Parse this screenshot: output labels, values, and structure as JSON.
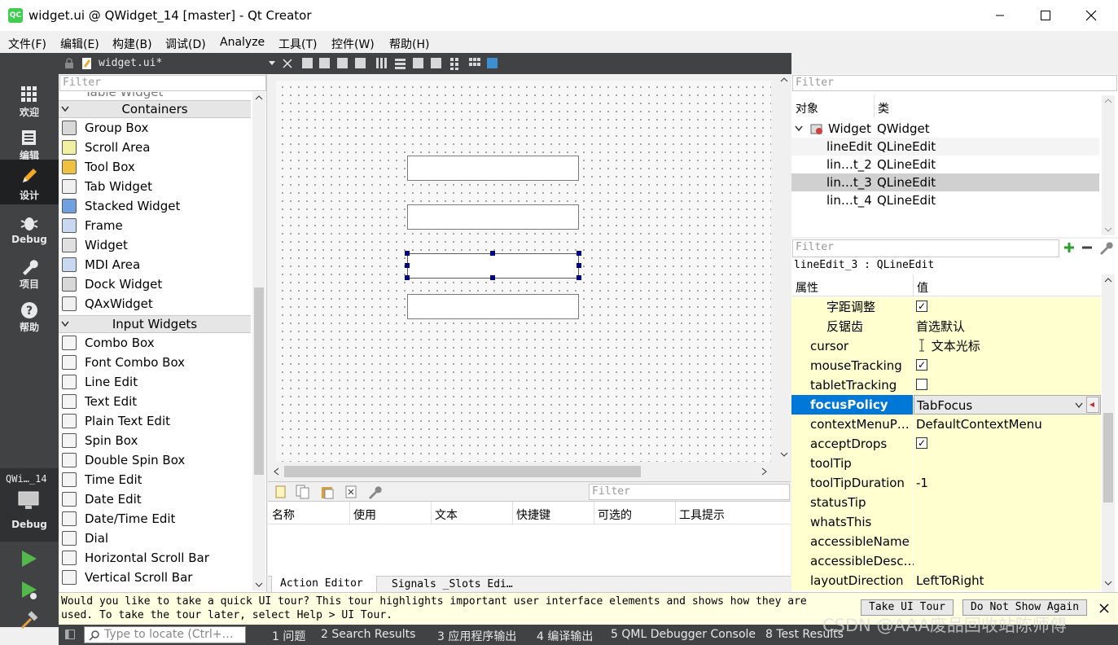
{
  "window": {
    "title": "widget.ui @ QWidget_14 [master] - Qt Creator",
    "app_icon": "QC"
  },
  "menu": [
    "文件(F)",
    "编辑(E)",
    "构建(B)",
    "调试(D)",
    "Analyze",
    "工具(T)",
    "控件(W)",
    "帮助(H)"
  ],
  "modes": [
    {
      "label": "欢迎",
      "icon": "grid-icon"
    },
    {
      "label": "编辑",
      "icon": "document-icon"
    },
    {
      "label": "设计",
      "icon": "pen-icon"
    },
    {
      "label": "Debug",
      "icon": "bug-icon"
    },
    {
      "label": "项目",
      "icon": "wrench-icon"
    },
    {
      "label": "帮助",
      "icon": "question-icon"
    }
  ],
  "kit": {
    "name": "QWi…_14",
    "config": "Debug"
  },
  "editor_tab": {
    "filename": "widget.ui*"
  },
  "widget_box": {
    "filter_placeholder": "Filter",
    "partial_top": "Table Widget",
    "containers_label": "Containers",
    "containers": [
      "Group Box",
      "Scroll Area",
      "Tool Box",
      "Tab Widget",
      "Stacked Widget",
      "Frame",
      "Widget",
      "MDI Area",
      "Dock Widget",
      "QAxWidget"
    ],
    "input_label": "Input Widgets",
    "inputs": [
      "Combo Box",
      "Font Combo Box",
      "Line Edit",
      "Text Edit",
      "Plain Text Edit",
      "Spin Box",
      "Double Spin Box",
      "Time Edit",
      "Date Edit",
      "Date/Time Edit",
      "Dial",
      "Horizontal Scroll Bar",
      "Vertical Scroll Bar"
    ]
  },
  "action_editor": {
    "filter_placeholder": "Filter",
    "columns": [
      "名称",
      "使用",
      "文本",
      "快捷键",
      "可选的",
      "工具提示"
    ],
    "tabs": [
      "Action Editor",
      "Signals _Slots Edi…"
    ]
  },
  "object_inspector": {
    "filter_placeholder": "Filter",
    "columns": [
      "对象",
      "类"
    ],
    "rows": [
      {
        "name": "Widget",
        "class": "QWidget"
      },
      {
        "name": "lineEdit",
        "class": "QLineEdit"
      },
      {
        "name": "lin…t_2",
        "class": "QLineEdit"
      },
      {
        "name": "lin…t_3",
        "class": "QLineEdit"
      },
      {
        "name": "lin…t_4",
        "class": "QLineEdit"
      }
    ]
  },
  "property_editor": {
    "filter_placeholder": "Filter",
    "selected": "lineEdit_3 : QLineEdit",
    "columns": [
      "属性",
      "值"
    ],
    "rows": [
      {
        "name": "字距调整",
        "value": "",
        "checkbox": true,
        "checked": true,
        "indent": 2
      },
      {
        "name": "反锯齿",
        "value": "首选默认",
        "indent": 2
      },
      {
        "name": "cursor",
        "value": "文本光标",
        "indent": 1,
        "icon": "text-cursor-icon"
      },
      {
        "name": "mouseTracking",
        "value": "",
        "checkbox": true,
        "checked": true,
        "indent": 1
      },
      {
        "name": "tabletTracking",
        "value": "",
        "checkbox": true,
        "checked": false,
        "indent": 1
      },
      {
        "name": "focusPolicy",
        "value": "TabFocus",
        "indent": 1,
        "selected": true
      },
      {
        "name": "contextMenuP…",
        "value": "DefaultContextMenu",
        "indent": 1
      },
      {
        "name": "acceptDrops",
        "value": "",
        "checkbox": true,
        "checked": true,
        "indent": 1
      },
      {
        "name": "toolTip",
        "value": "",
        "indent": 1,
        "expandable": true
      },
      {
        "name": "toolTipDuration",
        "value": "-1",
        "indent": 1
      },
      {
        "name": "statusTip",
        "value": "",
        "indent": 1,
        "expandable": true
      },
      {
        "name": "whatsThis",
        "value": "",
        "indent": 1,
        "expandable": true
      },
      {
        "name": "accessibleName",
        "value": "",
        "indent": 1,
        "expandable": true
      },
      {
        "name": "accessibleDesc…",
        "value": "",
        "indent": 1,
        "expandable": true
      },
      {
        "name": "layoutDirection",
        "value": "LeftToRight",
        "indent": 1
      }
    ]
  },
  "tour": {
    "message_line1": "Would you like to take a quick UI tour? This tour highlights important user interface elements and shows how they are",
    "message_line2": "used. To take the tour later, select Help > UI Tour.",
    "take_tour": "Take UI Tour",
    "dont_show": "Do Not Show Again"
  },
  "statusbar": {
    "locate_placeholder": "Type to locate (Ctrl+…",
    "panes": [
      "1 问题",
      "2 Search Results",
      "3 应用程序输出",
      "4 编译输出",
      "5 QML Debugger Console",
      "8 Test Results"
    ],
    "watermark": "CSDN @AAA废品回收站陈师傅"
  },
  "colors": {
    "sidebar": "#404244",
    "property_bg": "#ffffd0",
    "selection": "#0078d7",
    "handle": "#000080"
  }
}
